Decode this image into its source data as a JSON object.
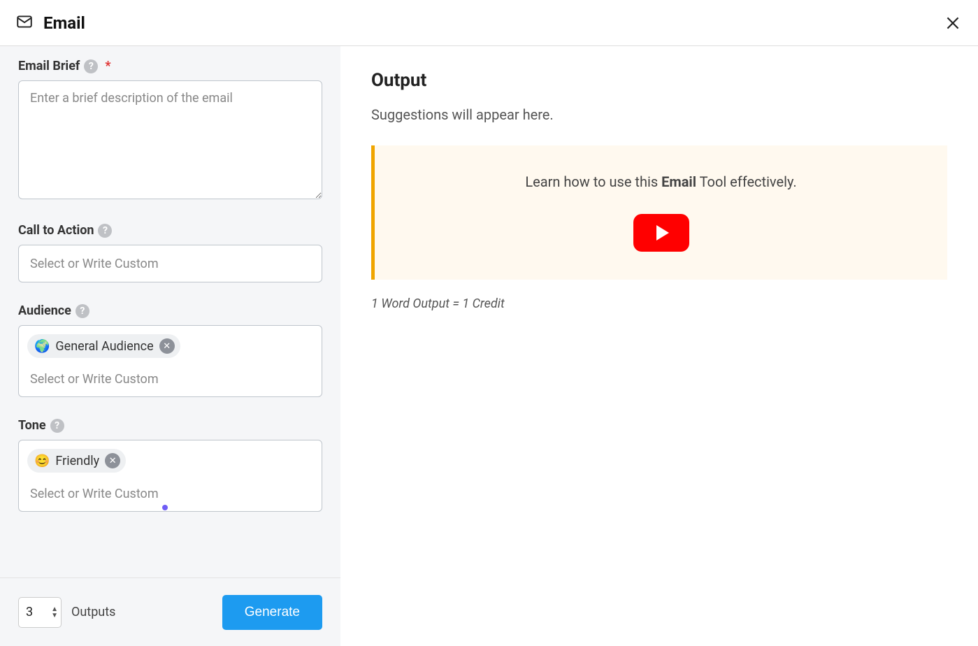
{
  "header": {
    "title": "Email"
  },
  "form": {
    "brief": {
      "label": "Email Brief",
      "required_mark": "*",
      "placeholder": "Enter a brief description of the email"
    },
    "cta": {
      "label": "Call to Action",
      "placeholder": "Select or Write Custom"
    },
    "audience": {
      "label": "Audience",
      "chip_emoji": "🌍",
      "chip_label": "General Audience",
      "placeholder": "Select or Write Custom"
    },
    "tone": {
      "label": "Tone",
      "chip_emoji": "😊",
      "chip_label": "Friendly",
      "placeholder": "Select or Write Custom"
    }
  },
  "bottom": {
    "outputs_count": "3",
    "outputs_label": "Outputs",
    "generate_label": "Generate"
  },
  "output": {
    "title": "Output",
    "placeholder": "Suggestions will appear here.",
    "tip_prefix": "Learn how to use this ",
    "tip_bold": "Email",
    "tip_suffix": " Tool effectively.",
    "credit_note": "1 Word Output = 1 Credit"
  }
}
